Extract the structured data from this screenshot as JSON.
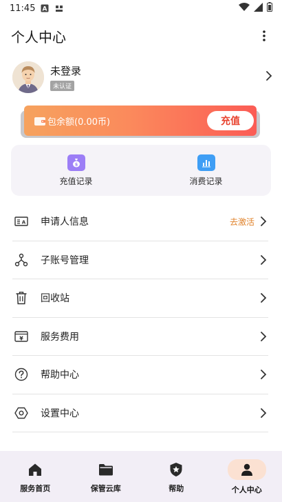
{
  "status_bar": {
    "time": "11:45"
  },
  "header": {
    "title": "个人中心"
  },
  "profile": {
    "name": "未登录",
    "badge": "未认证"
  },
  "balance": {
    "text": "包余额(0.00币)",
    "recharge_label": "充值"
  },
  "records": [
    {
      "label": "充值记录",
      "icon": "money-bag-icon",
      "color": "#9c7ef6"
    },
    {
      "label": "消费记录",
      "icon": "bar-chart-icon",
      "color": "#3f9ef5"
    }
  ],
  "menu": [
    {
      "label": "申请人信息",
      "icon": "id-card-icon",
      "extra": "去激活"
    },
    {
      "label": "子账号管理",
      "icon": "account-tree-icon"
    },
    {
      "label": "回收站",
      "icon": "trash-icon"
    },
    {
      "label": "服务费用",
      "icon": "yen-wallet-icon"
    },
    {
      "label": "帮助中心",
      "icon": "help-icon"
    },
    {
      "label": "设置中心",
      "icon": "settings-icon"
    }
  ],
  "bottom_nav": [
    {
      "label": "服务首页",
      "icon": "home-icon"
    },
    {
      "label": "保管云库",
      "icon": "folder-icon"
    },
    {
      "label": "帮助",
      "icon": "shield-star-icon"
    },
    {
      "label": "个人中心",
      "icon": "person-icon",
      "active": true
    }
  ],
  "colors": {
    "accent": "#fb5c55",
    "extra_text": "#e0822a",
    "nav_bg": "#f2eef6"
  }
}
